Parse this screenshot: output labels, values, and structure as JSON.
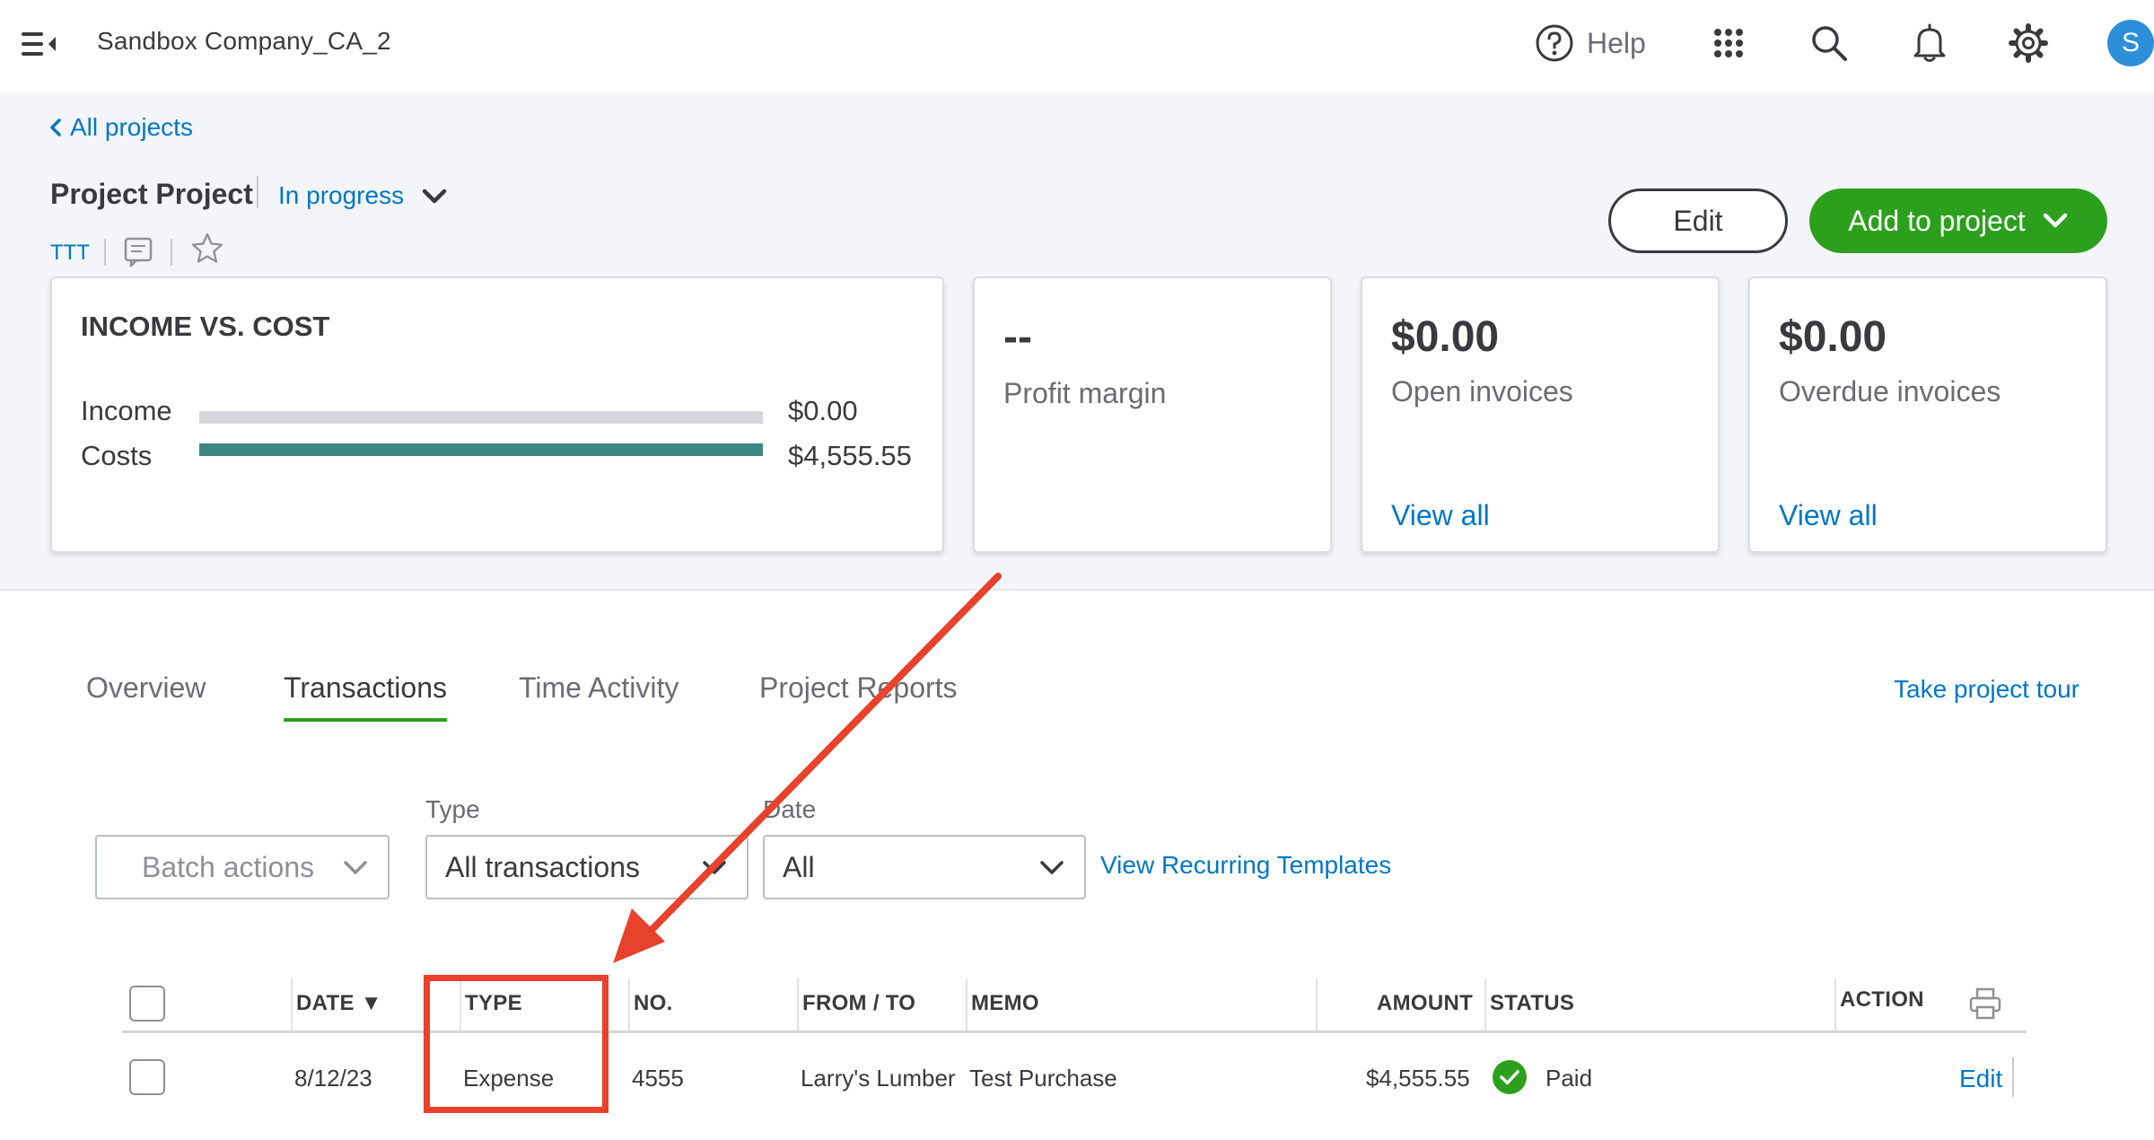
{
  "topbar": {
    "company_name": "Sandbox Company_CA_2",
    "help_label": "Help",
    "avatar_initial": "S",
    "icons": [
      "menu-collapse-icon",
      "help-circle-icon",
      "apps-grid-icon",
      "search-icon",
      "bell-icon",
      "gear-icon"
    ]
  },
  "header": {
    "back_link": "All projects",
    "project_name": "Project Project",
    "status": "In progress",
    "customer": "TTT",
    "edit_button": "Edit",
    "add_button": "Add to project"
  },
  "cards": {
    "income_vs_cost": {
      "title": "INCOME VS. COST",
      "income_label": "Income",
      "income_value": "$0.00",
      "costs_label": "Costs",
      "costs_value": "$4,555.55"
    },
    "profit_margin": {
      "value": "--",
      "label": "Profit margin"
    },
    "open_invoices": {
      "value": "$0.00",
      "label": "Open invoices",
      "link": "View all"
    },
    "overdue_invoices": {
      "value": "$0.00",
      "label": "Overdue invoices",
      "link": "View all"
    }
  },
  "tabs": [
    {
      "label": "Overview"
    },
    {
      "label": "Transactions",
      "active": true
    },
    {
      "label": "Time Activity"
    },
    {
      "label": "Project Reports"
    }
  ],
  "tour_link": "Take project tour",
  "filters": {
    "batch_actions": "Batch actions",
    "type_label": "Type",
    "type_value": "All transactions",
    "date_label": "Date",
    "date_value": "All",
    "recurring_link": "View Recurring Templates"
  },
  "table": {
    "headers": {
      "date": "DATE ▼",
      "type": "TYPE",
      "no": "NO.",
      "from_to": "FROM / TO",
      "memo": "MEMO",
      "amount": "AMOUNT",
      "status": "STATUS",
      "action": "ACTION"
    },
    "rows": [
      {
        "date": "8/12/23",
        "type": "Expense",
        "no": "4555",
        "from_to": "Larry's Lumber",
        "memo": "Test Purchase",
        "amount": "$4,555.55",
        "status": "Paid",
        "action": "Edit"
      }
    ]
  },
  "colors": {
    "brand_green": "#2ca01c",
    "link_blue": "#0077c5",
    "cost_bar_teal": "#3c8782",
    "income_bar_gray": "#d6d7dc",
    "annotation_red": "#e8412c"
  }
}
